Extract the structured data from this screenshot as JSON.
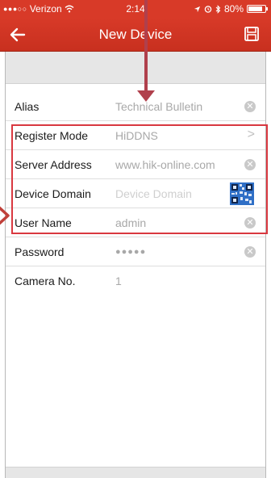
{
  "status_bar": {
    "signal": "●●●○○",
    "carrier": "Verizon",
    "wifi": "wifi-icon",
    "time": "2:14",
    "battery_pct": "80%"
  },
  "nav": {
    "title": "New Device",
    "back_icon": "back-arrow-icon",
    "save_icon": "save-icon"
  },
  "form": {
    "rows": [
      {
        "label": "Alias",
        "value": "Technical Bulletin",
        "accessory": "clear"
      },
      {
        "label": "Register Mode",
        "value": "HiDDNS",
        "accessory": "chevron"
      },
      {
        "label": "Server Address",
        "value": "www.hik-online.com",
        "accessory": "clear"
      },
      {
        "label": "Device Domain",
        "placeholder": "Device Domain",
        "accessory": "qr"
      },
      {
        "label": "User Name",
        "value": "admin",
        "accessory": "clear"
      },
      {
        "label": "Password",
        "value": "●●●●●",
        "accessory": "clear"
      },
      {
        "label": "Camera No.",
        "value": "1",
        "accessory": "none"
      }
    ]
  },
  "colors": {
    "brand": "#d83a28",
    "annotation": "#d93840"
  }
}
